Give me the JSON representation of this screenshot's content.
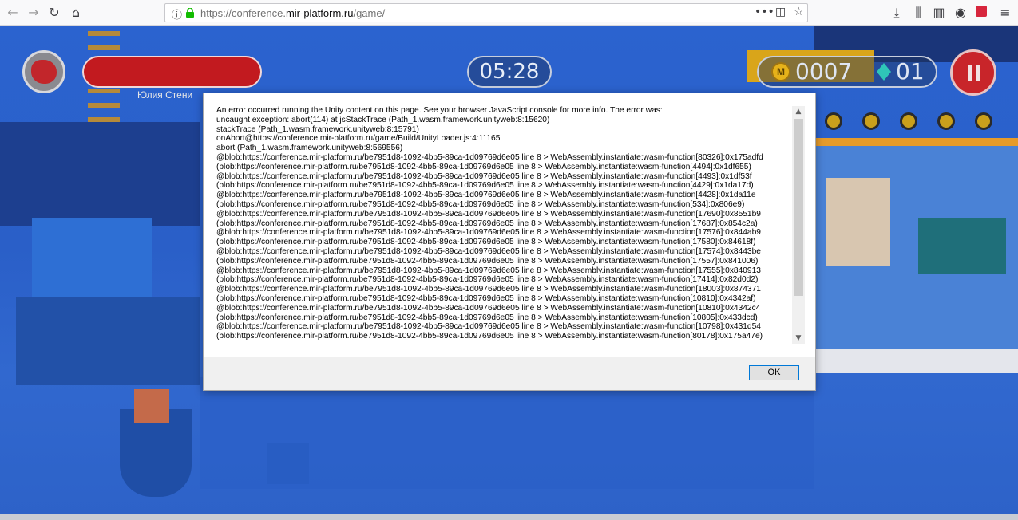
{
  "browser": {
    "url_host_prefix": "https://conference.",
    "url_host_domain": "mir-platform.ru",
    "url_path": "/game/",
    "info_icon": "info-icon",
    "lock_icon": "lock-icon"
  },
  "hud": {
    "player_name": "Юлия Стени",
    "timer": "05:28",
    "coins": "0007",
    "gems": "01",
    "coin_symbol": "M"
  },
  "dialog": {
    "lines": [
      "An error occurred running the Unity content on this page. See your browser JavaScript console for more info. The error was:",
      "uncaught exception: abort(114) at jsStackTrace (Path_1.wasm.framework.unityweb:8:15620)",
      "stackTrace (Path_1.wasm.framework.unityweb:8:15791)",
      "onAbort@https://conference.mir-platform.ru/game/Build/UnityLoader.js:4:11165",
      "abort (Path_1.wasm.framework.unityweb:8:569556)",
      "@blob:https://conference.mir-platform.ru/be7951d8-1092-4bb5-89ca-1d09769d6e05 line 8 > WebAssembly.instantiate:wasm-function[80326]:0x175adfd",
      "(blob:https://conference.mir-platform.ru/be7951d8-1092-4bb5-89ca-1d09769d6e05 line 8 > WebAssembly.instantiate:wasm-function[4494]:0x1df655)",
      "@blob:https://conference.mir-platform.ru/be7951d8-1092-4bb5-89ca-1d09769d6e05 line 8 > WebAssembly.instantiate:wasm-function[4493]:0x1df53f",
      "(blob:https://conference.mir-platform.ru/be7951d8-1092-4bb5-89ca-1d09769d6e05 line 8 > WebAssembly.instantiate:wasm-function[4429]:0x1da17d)",
      "@blob:https://conference.mir-platform.ru/be7951d8-1092-4bb5-89ca-1d09769d6e05 line 8 > WebAssembly.instantiate:wasm-function[4428]:0x1da11e",
      "(blob:https://conference.mir-platform.ru/be7951d8-1092-4bb5-89ca-1d09769d6e05 line 8 > WebAssembly.instantiate:wasm-function[534]:0x806e9)",
      "@blob:https://conference.mir-platform.ru/be7951d8-1092-4bb5-89ca-1d09769d6e05 line 8 > WebAssembly.instantiate:wasm-function[17690]:0x8551b9",
      "(blob:https://conference.mir-platform.ru/be7951d8-1092-4bb5-89ca-1d09769d6e05 line 8 > WebAssembly.instantiate:wasm-function[17687]:0x854c2a)",
      "@blob:https://conference.mir-platform.ru/be7951d8-1092-4bb5-89ca-1d09769d6e05 line 8 > WebAssembly.instantiate:wasm-function[17576]:0x844ab9",
      "(blob:https://conference.mir-platform.ru/be7951d8-1092-4bb5-89ca-1d09769d6e05 line 8 > WebAssembly.instantiate:wasm-function[17580]:0x84618f)",
      "@blob:https://conference.mir-platform.ru/be7951d8-1092-4bb5-89ca-1d09769d6e05 line 8 > WebAssembly.instantiate:wasm-function[17574]:0x8443be",
      "(blob:https://conference.mir-platform.ru/be7951d8-1092-4bb5-89ca-1d09769d6e05 line 8 > WebAssembly.instantiate:wasm-function[17557]:0x841006)",
      "@blob:https://conference.mir-platform.ru/be7951d8-1092-4bb5-89ca-1d09769d6e05 line 8 > WebAssembly.instantiate:wasm-function[17555]:0x840913",
      "(blob:https://conference.mir-platform.ru/be7951d8-1092-4bb5-89ca-1d09769d6e05 line 8 > WebAssembly.instantiate:wasm-function[17414]:0x82d0d2)",
      "@blob:https://conference.mir-platform.ru/be7951d8-1092-4bb5-89ca-1d09769d6e05 line 8 > WebAssembly.instantiate:wasm-function[18003]:0x874371",
      "(blob:https://conference.mir-platform.ru/be7951d8-1092-4bb5-89ca-1d09769d6e05 line 8 > WebAssembly.instantiate:wasm-function[10810]:0x4342af)",
      "@blob:https://conference.mir-platform.ru/be7951d8-1092-4bb5-89ca-1d09769d6e05 line 8 > WebAssembly.instantiate:wasm-function[10810]:0x4342c4",
      "(blob:https://conference.mir-platform.ru/be7951d8-1092-4bb5-89ca-1d09769d6e05 line 8 > WebAssembly.instantiate:wasm-function[10805]:0x433dcd)",
      "@blob:https://conference.mir-platform.ru/be7951d8-1092-4bb5-89ca-1d09769d6e05 line 8 > WebAssembly.instantiate:wasm-function[10798]:0x431d54",
      "(blob:https://conference.mir-platform.ru/be7951d8-1092-4bb5-89ca-1d09769d6e05 line 8 > WebAssembly.instantiate:wasm-function[80178]:0x175a47e)"
    ],
    "ok_label": "OK"
  }
}
